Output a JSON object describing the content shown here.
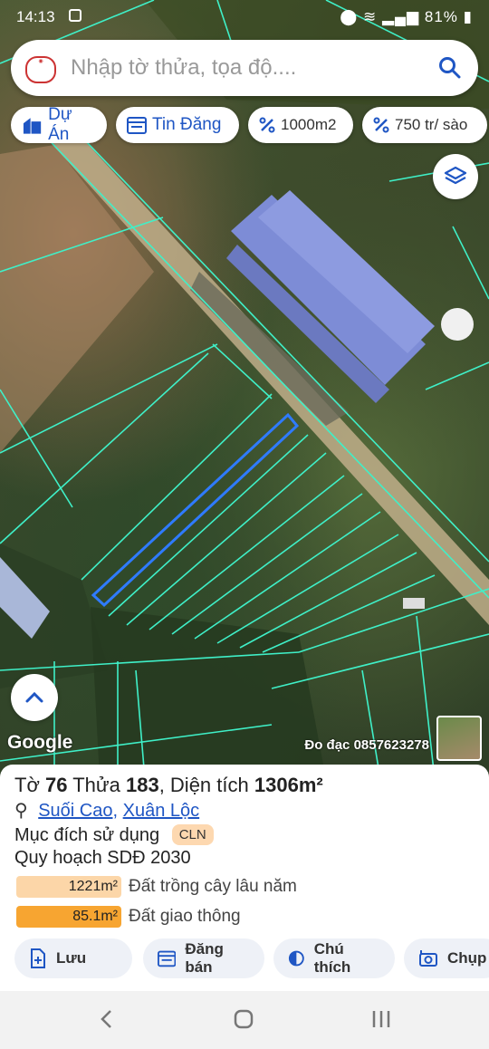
{
  "status": {
    "time": "14:13",
    "battery": "81%"
  },
  "search": {
    "placeholder": "Nhập tờ thửa, tọa độ...."
  },
  "chips": {
    "du_an": "Dự Án",
    "tin_dang": "Tin Đăng",
    "area": "1000m2",
    "price": "750 tr/ sào"
  },
  "map": {
    "google_label": "Google",
    "contact": "Đo đạc 0857623278"
  },
  "parcel": {
    "to_label": "Tờ",
    "to": "76",
    "thua_label": "Thửa",
    "thua": "183",
    "area_label": "Diện tích",
    "area": "1306m²",
    "commune": "Suối Cao",
    "district": "Xuân Lộc",
    "purpose_label": "Mục đích sử dụng",
    "purpose_code": "CLN",
    "plan_label": "Quy hoạch SDĐ 2030",
    "plan_items": [
      {
        "area": "1221m²",
        "label": "Đất trồng cây lâu năm",
        "color": "#fcd6a8"
      },
      {
        "area": "85.1m²",
        "label": "Đất giao thông",
        "color": "#f7a531"
      }
    ]
  },
  "actions": {
    "save": "Lưu",
    "post": "Đăng bán",
    "legend": "Chú thích",
    "capture": "Chụp"
  },
  "colors": {
    "accent": "#1f56c4",
    "parcel_line": "#3ff0c8",
    "selected_parcel": "#2f7bff"
  }
}
